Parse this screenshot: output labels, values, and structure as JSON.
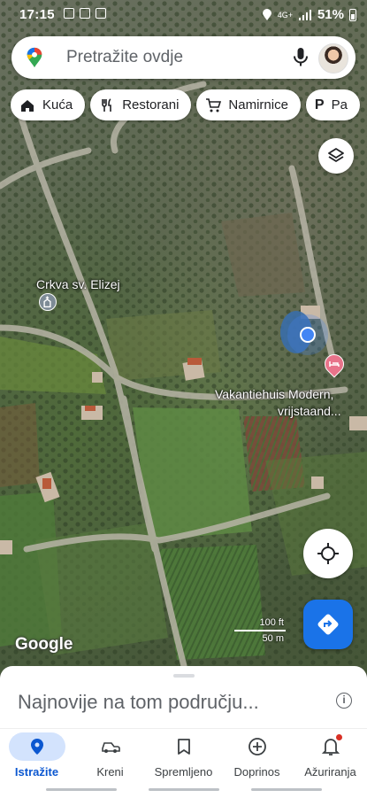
{
  "status_bar": {
    "time": "17:15",
    "battery": "51%",
    "network": "4G+"
  },
  "search": {
    "placeholder": "Pretražite ovdje"
  },
  "chips": [
    {
      "label": "Kuća",
      "icon": "home-icon"
    },
    {
      "label": "Restorani",
      "icon": "restaurant-icon"
    },
    {
      "label": "Namirnice",
      "icon": "cart-icon"
    },
    {
      "label": "Pa",
      "icon": "parking-icon"
    }
  ],
  "map": {
    "place_labels": [
      "Crkva sv. Elizej",
      "Vakantiehuis Modern,",
      "vrijstaand..."
    ],
    "logo": "Google",
    "scale": {
      "imperial": "100 ft",
      "metric": "50 m"
    }
  },
  "sheet": {
    "title": "Najnovije na tom području..."
  },
  "nav": [
    {
      "label": "Istražite",
      "icon": "explore-pin-icon",
      "active": true
    },
    {
      "label": "Kreni",
      "icon": "car-icon"
    },
    {
      "label": "Spremljeno",
      "icon": "bookmark-icon"
    },
    {
      "label": "Doprinos",
      "icon": "add-circle-icon"
    },
    {
      "label": "Ažuriranja",
      "icon": "bell-icon"
    }
  ],
  "colors": {
    "accent": "#1a73e8",
    "nav_active_bg": "#d3e3fd",
    "notification_dot": "#d93025"
  }
}
